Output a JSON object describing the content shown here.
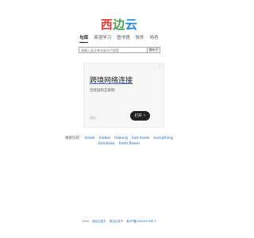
{
  "logo": {
    "chars": [
      "西",
      "边",
      "云"
    ]
  },
  "nav": {
    "tabs": [
      {
        "label": "句库",
        "active": true
      },
      {
        "label": "英语学习",
        "active": false
      },
      {
        "label": "图书馆",
        "active": false
      },
      {
        "label": "软件",
        "active": false
      },
      {
        "label": "特色",
        "active": false
      }
    ]
  },
  "search": {
    "placeholder": "请输入英文单词或句子搜索",
    "button_label": "搜句子"
  },
  "ad": {
    "title": "跨境网络连接",
    "subtitle": "连接国际互联网",
    "advertiser": "司乐",
    "open_label": "打开",
    "open_arrow": "›"
  },
  "related": {
    "label": "搜索历史:",
    "row1": [
      "made",
      "makes",
      "making",
      "had made",
      "everything"
    ],
    "row2": [
      "tomatoes",
      "fresh flower"
    ]
  },
  "footer": {
    "items": [
      "2020",
      "西边云官方",
      "西边云关于",
      "粤ICP备10005274号-1"
    ]
  }
}
